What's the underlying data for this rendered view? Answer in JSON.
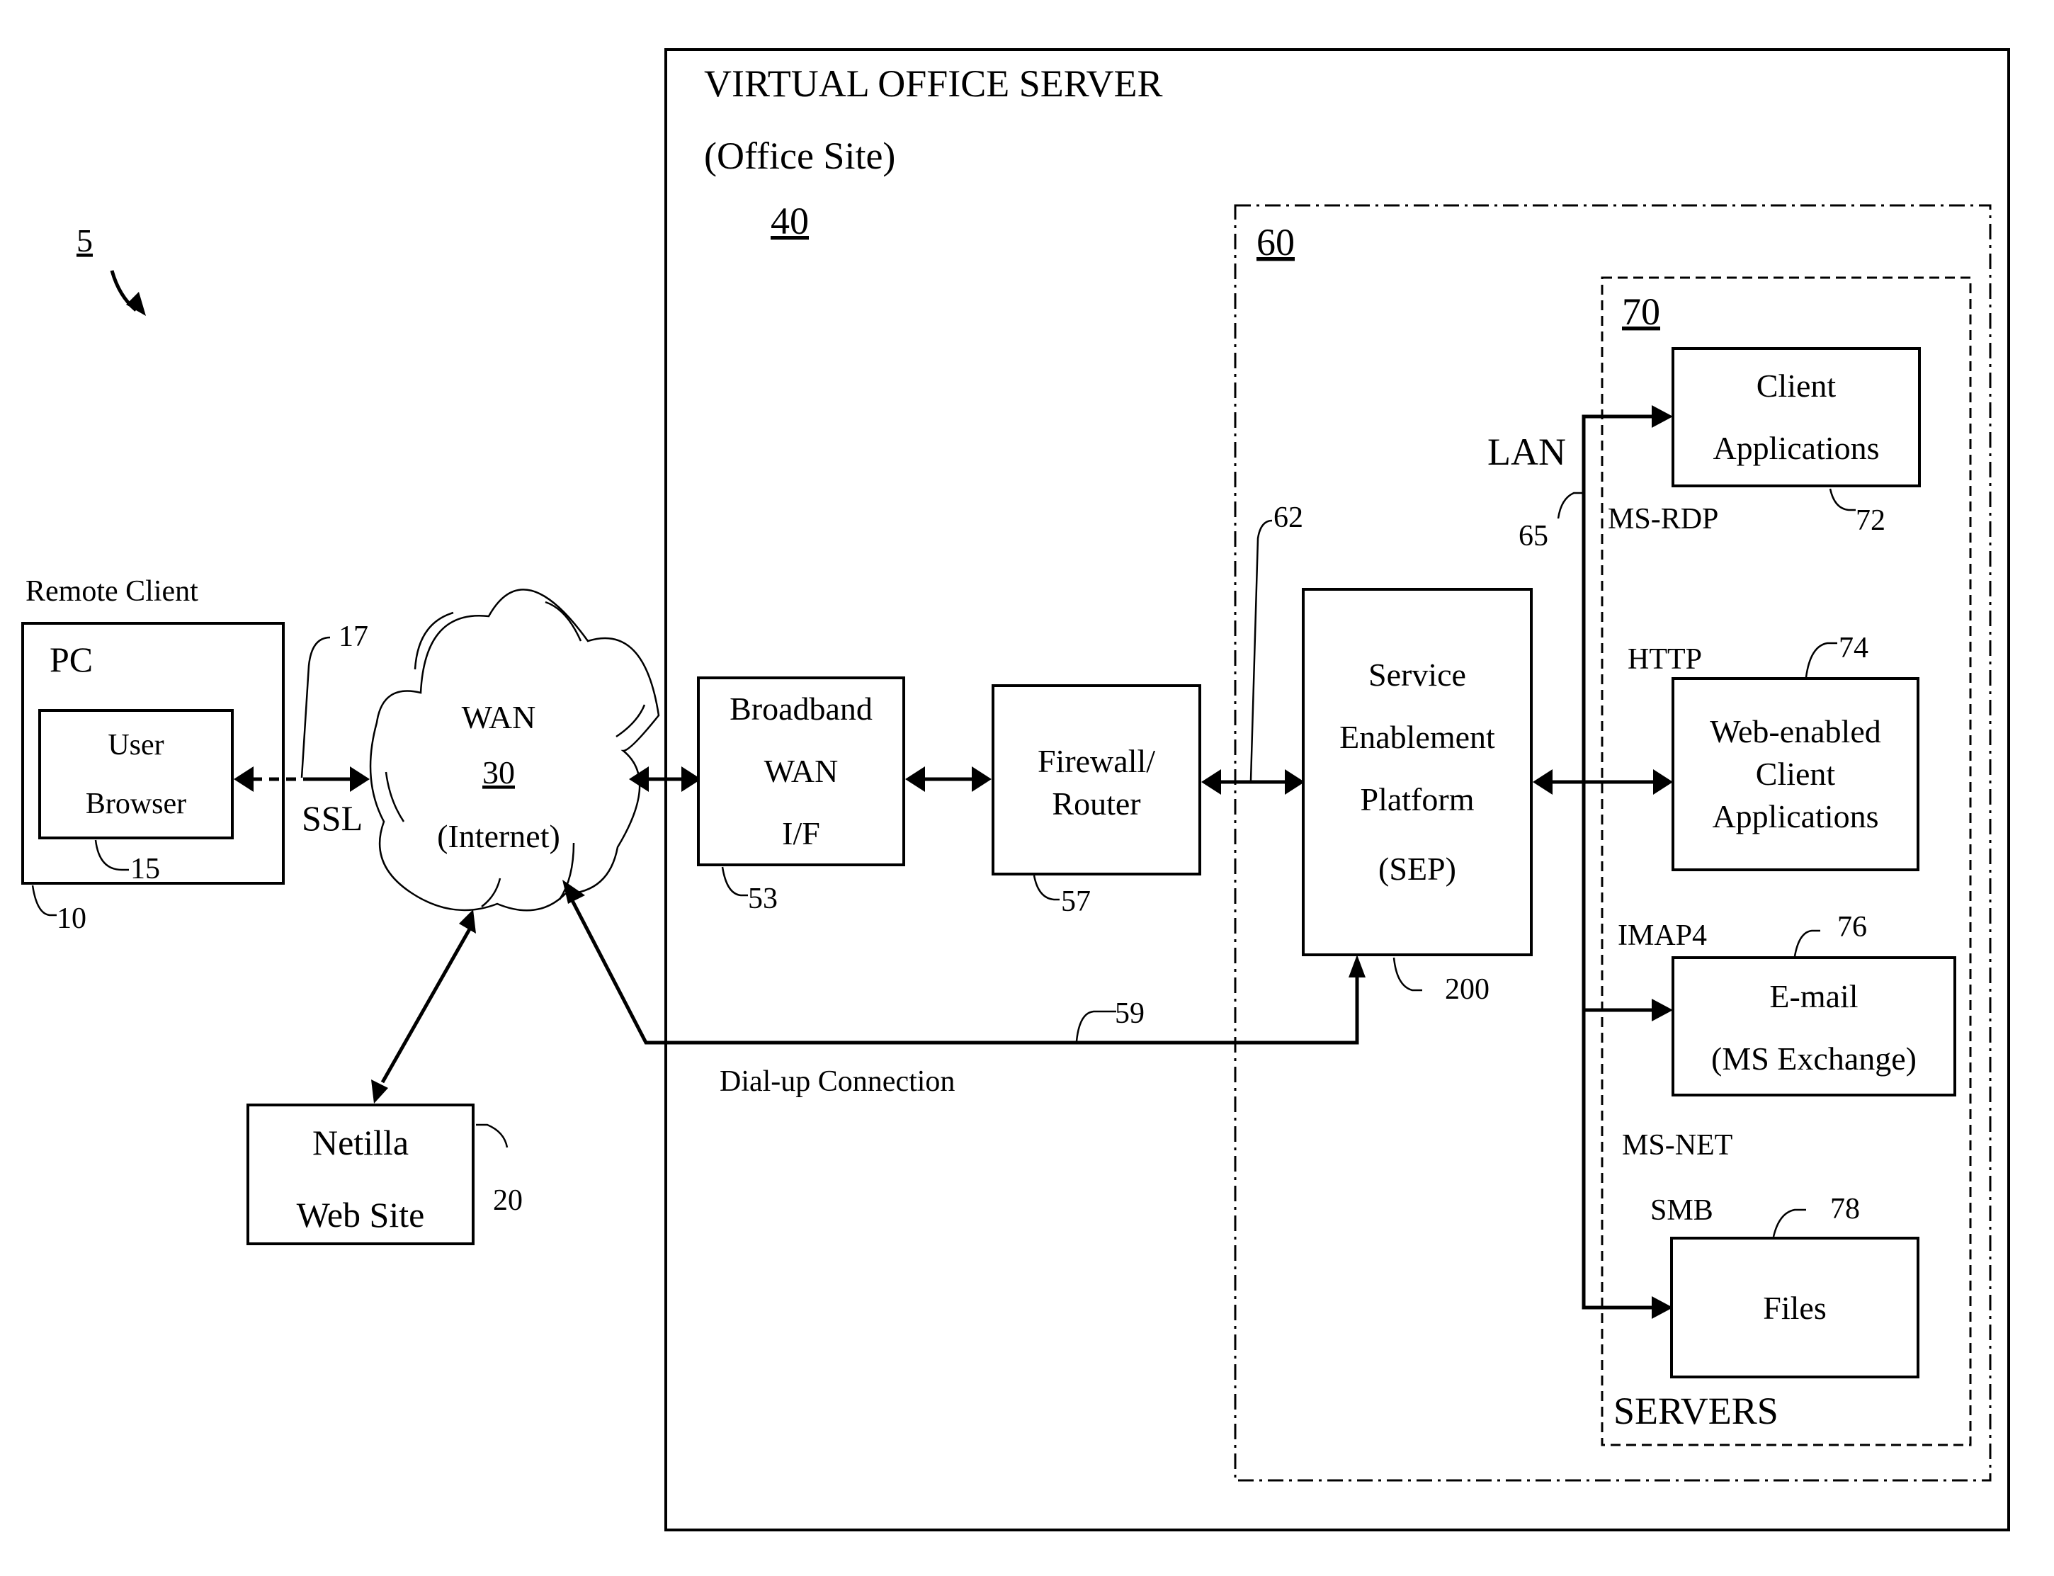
{
  "figure": {
    "ref": "5",
    "colors": {
      "ink": "#000000",
      "paper": "#ffffff"
    }
  },
  "remote_client": {
    "heading": "Remote Client",
    "pc": {
      "label": "PC",
      "ref": "10"
    },
    "browser": {
      "line1": "User",
      "line2": "Browser",
      "ref": "15"
    },
    "link": {
      "label": "SSL",
      "ref": "17"
    }
  },
  "wan": {
    "line1": "WAN",
    "ref": "30",
    "line3": "(Internet)"
  },
  "netilla": {
    "line1": "Netilla",
    "line2": "Web Site",
    "ref": "20"
  },
  "office": {
    "title": "VIRTUAL OFFICE SERVER",
    "subtitle": "(Office Site)",
    "ref": "40",
    "broadband": {
      "line1": "Broadband",
      "line2": "WAN",
      "line3": "I/F",
      "ref": "53"
    },
    "firewall": {
      "line1": "Firewall/",
      "line2": "Router",
      "ref": "57"
    },
    "dialup": {
      "label": "Dial-up  Connection",
      "ref": "59"
    }
  },
  "platform_group": {
    "ref": "60",
    "link_ref": "62",
    "sep": {
      "line1": "Service",
      "line2": "Enablement",
      "line3": "Platform",
      "line4": "(SEP)",
      "ref": "200"
    },
    "lan": {
      "label": "LAN",
      "ref": "65"
    }
  },
  "servers": {
    "ref": "70",
    "label": "SERVERS",
    "items": [
      {
        "protocol": "MS-RDP",
        "lines": [
          "Client",
          "Applications"
        ],
        "ref": "72"
      },
      {
        "protocol": "HTTP",
        "lines": [
          "Web-enabled",
          "Client",
          "Applications"
        ],
        "ref": "74"
      },
      {
        "protocol": "IMAP4",
        "lines": [
          "E-mail",
          "(MS Exchange)"
        ],
        "ref": "76"
      },
      {
        "protocol": "SMB",
        "protocol_group": "MS-NET",
        "lines": [
          "Files"
        ],
        "ref": "78"
      }
    ]
  }
}
